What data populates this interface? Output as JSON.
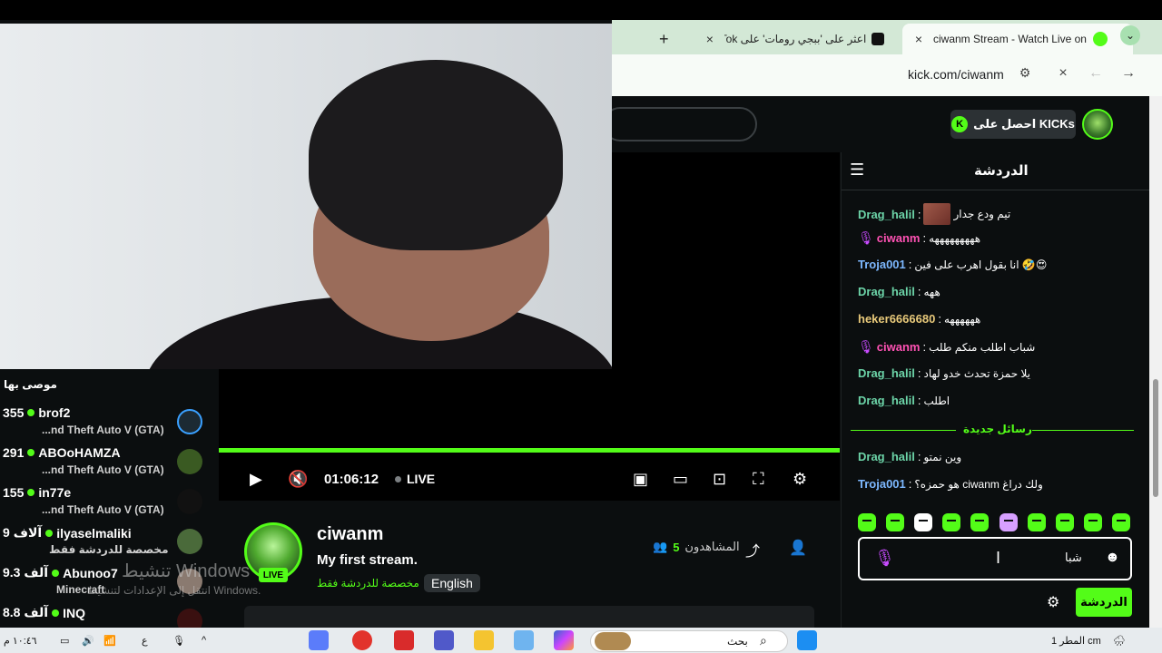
{
  "browser": {
    "tabs": [
      {
        "label": "ciwanm Stream - Watch Live on",
        "active": true
      },
      {
        "label": "اعثر على 'ببجي رومات' على TikTok",
        "active": false
      }
    ],
    "new_tab_icon": "+",
    "url": "kick.com/ciwanm"
  },
  "header": {
    "get_kicks_label": "احصل على KICKs",
    "kick_icon_letter": "K"
  },
  "player": {
    "time": "01:06:12",
    "live_label": "LIVE",
    "progress_fraction": 1.0
  },
  "stream": {
    "channel_name": "ciwanm",
    "title": "My first stream.",
    "category": "مخصصة للدردشة فقط",
    "language": "English",
    "live_badge": "LIVE",
    "viewers_label": "المشاهدون",
    "viewers_count": "5"
  },
  "recommended": {
    "title": "موصى بها",
    "items": [
      {
        "name": "brof2",
        "count": "355",
        "category": "...nd Theft Auto V (GTA)"
      },
      {
        "name": "ABOoHAMZA",
        "count": "291",
        "category": "...nd Theft Auto V (GTA)"
      },
      {
        "name": "in77e",
        "count": "155",
        "category": "...nd Theft Auto V (GTA)"
      },
      {
        "name": "ilyaselmaliki",
        "count": "9 آلاف",
        "category": "مخصصة للدردشة فقط"
      },
      {
        "name": "Abunoo7",
        "count": "9.3 آلف",
        "category": "Minecraft"
      },
      {
        "name": "INQ",
        "count": "8.8 آلف",
        "category": ""
      }
    ]
  },
  "chat": {
    "title": "الدردشة",
    "new_messages_label": "رسائل جديدة",
    "messages": [
      {
        "user": "Drag_halil",
        "color": "#6cd4a8",
        "text": "تيم ودع جدار",
        "thumb": true,
        "mic": false
      },
      {
        "user": "ciwanm",
        "color": "#ff52b4",
        "text": "هههههههههه",
        "thumb": false,
        "mic": true
      },
      {
        "user": "Troja001",
        "color": "#7db8ff",
        "text": "انا بقول اهرب على فين 🤣😍",
        "thumb": false,
        "mic": false
      },
      {
        "user": "Drag_halil",
        "color": "#6cd4a8",
        "text": "ههه",
        "thumb": false,
        "mic": false
      },
      {
        "user": "heker6666680",
        "color": "#e8c97a",
        "text": "ههههههه",
        "thumb": false,
        "mic": false
      },
      {
        "user": "ciwanm",
        "color": "#ff52b4",
        "text": "شباب اطلب منكم طلب",
        "thumb": false,
        "mic": true
      },
      {
        "user": "Drag_halil",
        "color": "#6cd4a8",
        "text": "يلا حمزة تحدث خدو لهاد",
        "thumb": false,
        "mic": false
      },
      {
        "user": "Drag_halil",
        "color": "#6cd4a8",
        "text": "اطلب",
        "thumb": false,
        "mic": false
      },
      {
        "user": "Drag_halil",
        "color": "#6cd4a8",
        "text": "وين نمتو",
        "thumb": false,
        "mic": false
      },
      {
        "user": "Troja001",
        "color": "#7db8ff",
        "text": "هو حمزه؟ ciwanm ولك دراغ",
        "thumb": false,
        "mic": false
      }
    ],
    "input_value": "شبا",
    "send_label": "الدردشة"
  },
  "watermark": {
    "line1": "تنشيط Windows",
    "line2": "انتقل إلى الإعدادات لتنشيط Windows."
  },
  "taskbar": {
    "search_label": "بحث",
    "weather": "المطر 1 cm",
    "time": "١٠:٤٦ م",
    "lang": "ع"
  },
  "colors": {
    "accent": "#53fc18",
    "background": "#0b0e0f"
  }
}
